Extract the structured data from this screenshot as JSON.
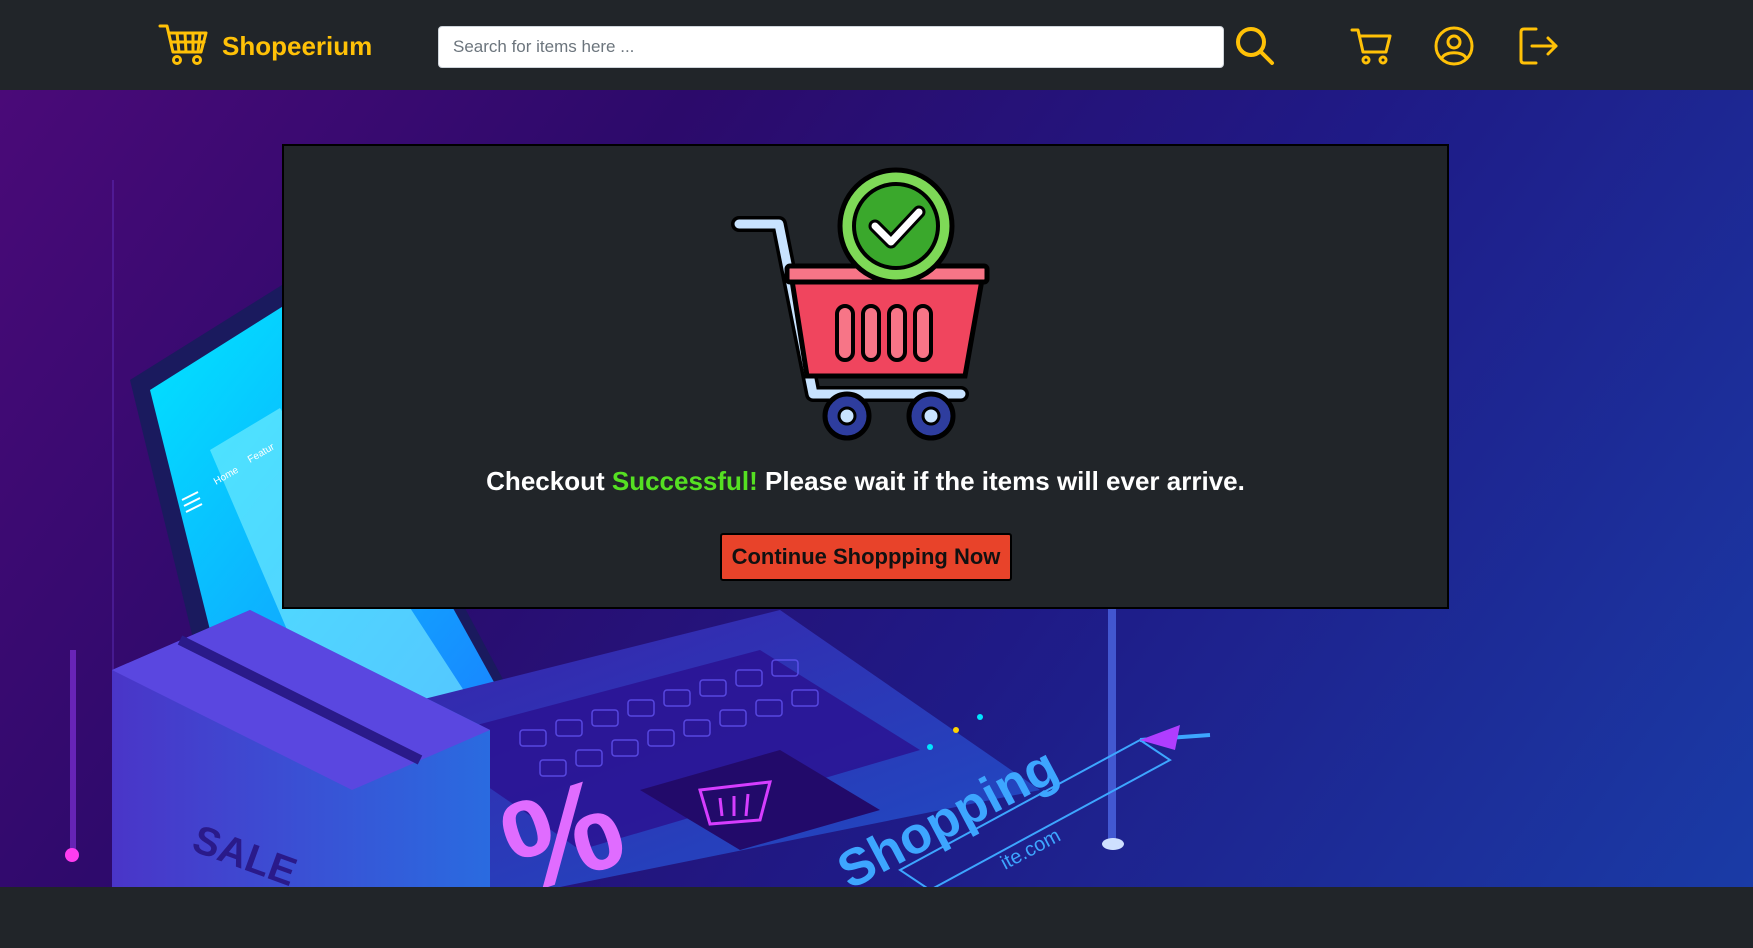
{
  "header": {
    "brand_name": "Shopeerium",
    "search": {
      "placeholder": "Search for items here ...",
      "value": ""
    },
    "icons": [
      "search-icon",
      "cart-icon",
      "user-icon",
      "logout-icon"
    ],
    "accent_color": "#ffc107"
  },
  "hero": {
    "screen_labels": [
      "Home",
      "Featur"
    ],
    "keycap_text": "SALE",
    "percent_glyph": "%",
    "shopping_text": "Shopping",
    "url_fragment": "ite.com"
  },
  "modal": {
    "message_prefix": "Checkout",
    "message_highlight": "Successful!",
    "message_suffix": "Please wait if the items will ever arrive.",
    "highlight_color": "#55e022",
    "continue_button_label": "Continue Shoppping Now",
    "button_color": "#e8432a",
    "illustration": "cart-success-icon"
  }
}
